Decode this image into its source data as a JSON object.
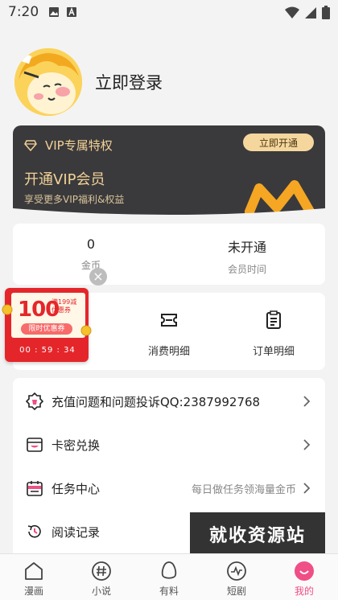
{
  "status_bar": {
    "time": "7:20"
  },
  "profile": {
    "login_label": "立即登录"
  },
  "vip": {
    "header": "VIP专属特权",
    "open_button": "立即开通",
    "title": "开通VIP会员",
    "subtitle": "享受更多VIP福利&权益",
    "accent_color": "#f3d197"
  },
  "stats": [
    {
      "value": "0",
      "label": "金币"
    },
    {
      "value": "未开通",
      "label": "会员时间"
    }
  ],
  "coupon": {
    "amount": "100",
    "condition_line1": "满199减",
    "condition_line2": "优惠券",
    "limit": "限时优惠券",
    "timer": "00 : 59 : 34"
  },
  "orders": [
    {
      "label": "消费明细",
      "icon": "ticket-icon"
    },
    {
      "label": "订单明细",
      "icon": "clipboard-icon"
    }
  ],
  "menu": [
    {
      "label": "充值问题和问题投诉QQ:2387992768",
      "extra": "",
      "icon": "badge-icon",
      "chevron": true
    },
    {
      "label": "卡密兑换",
      "extra": "",
      "icon": "card-icon",
      "chevron": true
    },
    {
      "label": "任务中心",
      "extra": "每日做任务领海量金币",
      "icon": "calendar-icon",
      "chevron": true
    },
    {
      "label": "阅读记录",
      "extra": "",
      "icon": "history-icon",
      "chevron": false
    }
  ],
  "watermark": "就收资源站",
  "tabs": [
    {
      "label": "漫画",
      "icon": "home-icon",
      "active": false
    },
    {
      "label": "小说",
      "icon": "hash-icon",
      "active": false
    },
    {
      "label": "有料",
      "icon": "egg-icon",
      "active": false
    },
    {
      "label": "短剧",
      "icon": "pulse-icon",
      "active": false
    },
    {
      "label": "我的",
      "icon": "profile-icon",
      "active": true
    }
  ],
  "colors": {
    "active_tab": "#f04e86",
    "coupon_red": "#e4262b"
  }
}
